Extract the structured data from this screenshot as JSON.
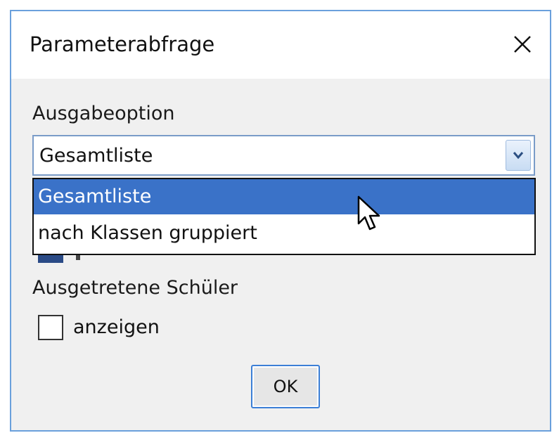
{
  "dialog": {
    "title": "Parameterabfrage",
    "close_icon": "close-icon",
    "accent_color": "#6aa0dc"
  },
  "ausgabe": {
    "label": "Ausgabeoption",
    "selected_value": "Gesamtliste",
    "options": [
      {
        "label": "Gesamtliste",
        "highlighted": true
      },
      {
        "label": "nach Klassen gruppiert",
        "highlighted": false
      }
    ],
    "arrow_icon": "chevron-down-icon",
    "highlight_color": "#3a72c8"
  },
  "ausgetreten": {
    "label": "Ausgetretene Schüler",
    "checkbox_label": "anzeigen",
    "checked": false
  },
  "buttons": {
    "ok_label": "OK"
  },
  "cursor_icon": "mouse-pointer-icon"
}
